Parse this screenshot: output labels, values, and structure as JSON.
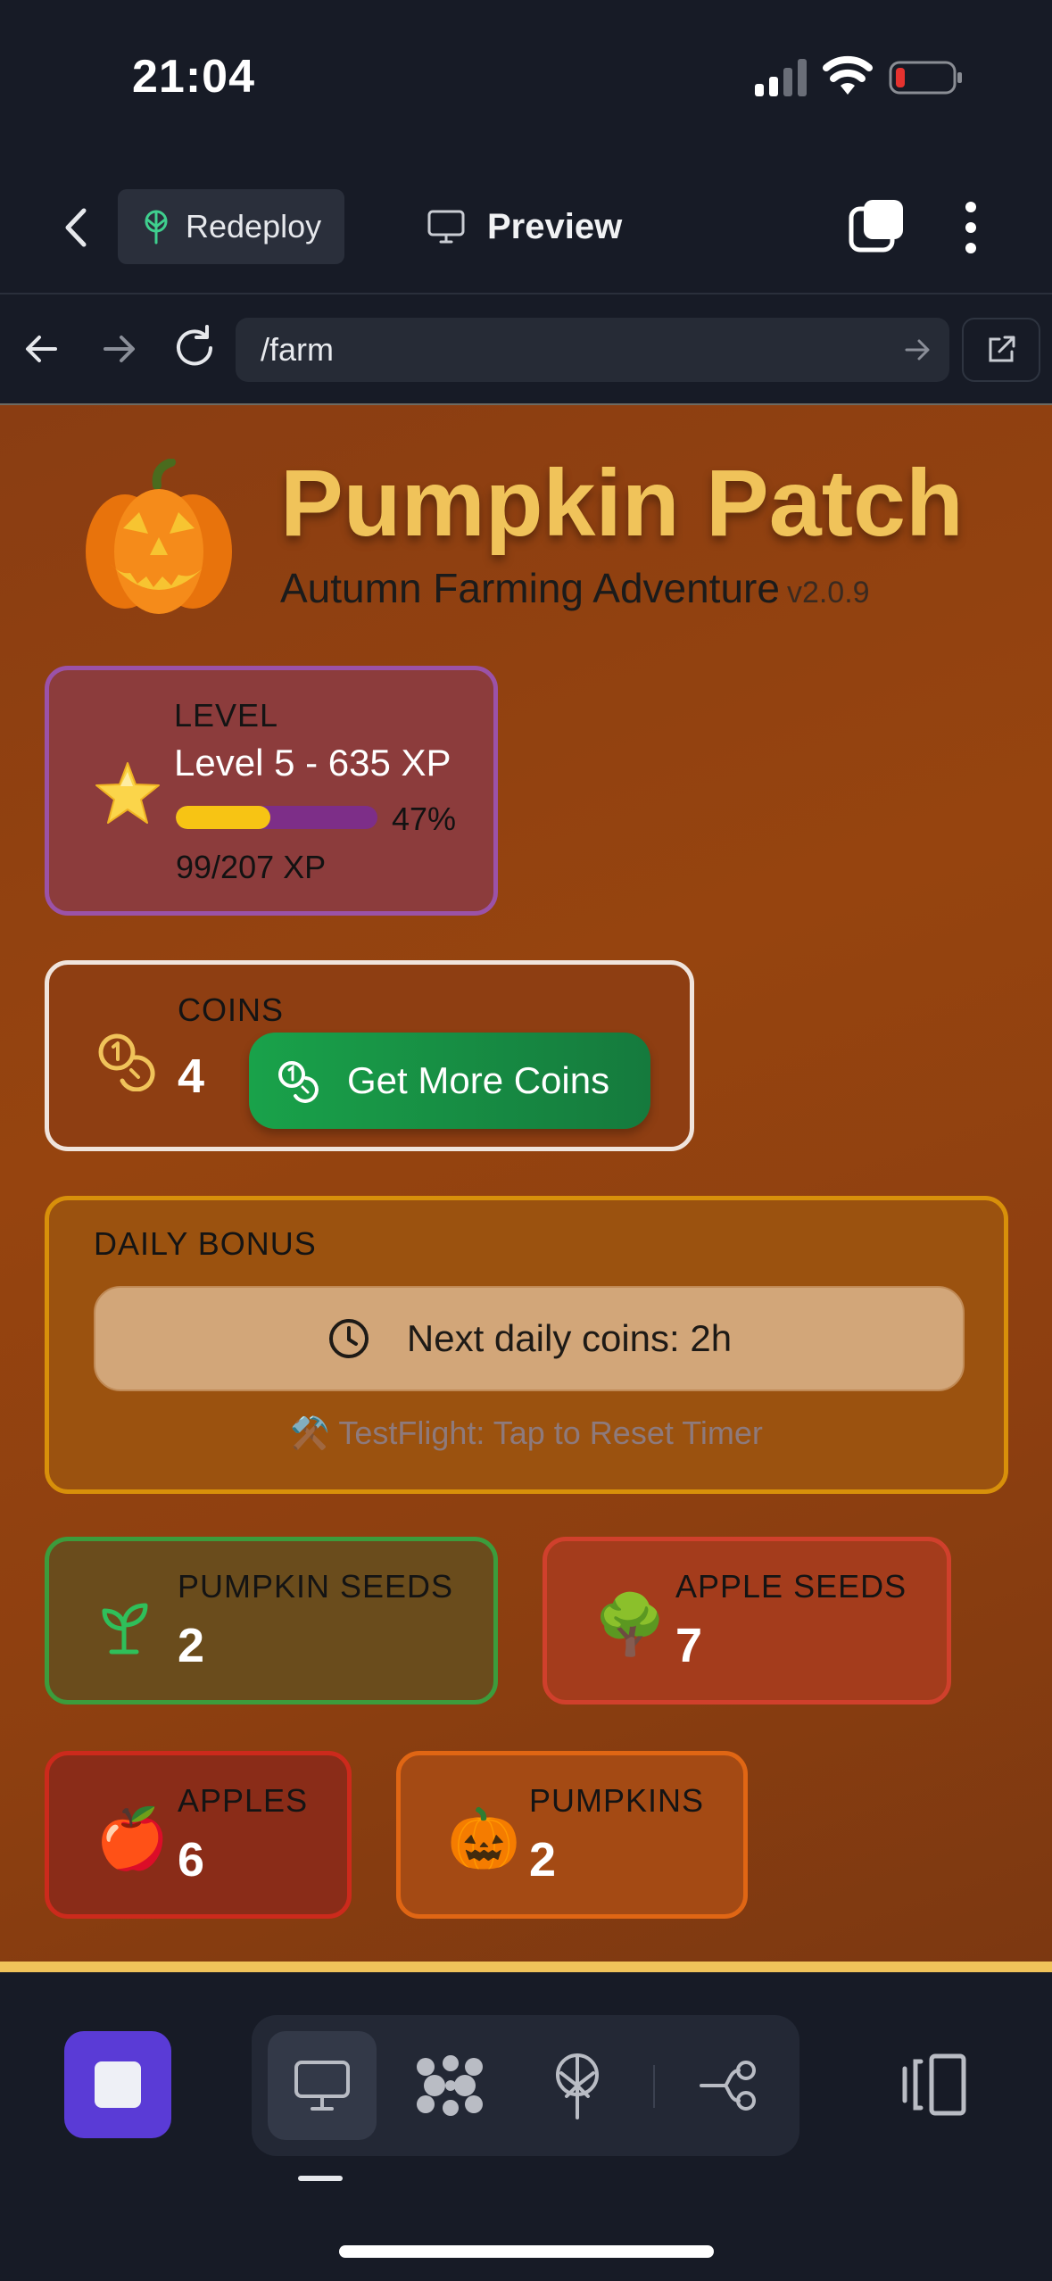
{
  "status_bar": {
    "time": "21:04",
    "icons": [
      "cellular-signal-icon",
      "wifi-icon",
      "battery-low-icon"
    ],
    "battery_color": "#e5322f"
  },
  "app_header": {
    "redeploy_label": "Redeploy",
    "preview_label": "Preview",
    "icons": [
      "back-chevron-icon",
      "redeploy-tree-icon",
      "monitor-icon",
      "tabs-icon",
      "more-vertical-icon"
    ],
    "redeploy_icon_color": "#3fcf8e"
  },
  "url_bar": {
    "value": "/farm",
    "icons": [
      "arrow-left-icon",
      "arrow-right-icon",
      "reload-icon",
      "go-arrow-icon",
      "external-link-icon"
    ]
  },
  "game": {
    "title": "Pumpkin Patch",
    "subtitle": "Autumn Farming Adventure",
    "version": "v2.0.9",
    "title_color": "#f0c35a",
    "level": {
      "caption": "LEVEL",
      "text": "Level 5 - 635 XP",
      "progress_fraction": 0.47,
      "progress_text": "47%",
      "xp_text": "99/207 XP",
      "icon": "star-icon"
    },
    "coins": {
      "caption": "COINS",
      "value": "4",
      "button_label": "Get More Coins",
      "icon": "coins-icon",
      "button_color": "#19a24a"
    },
    "daily_bonus": {
      "caption": "DAILY BONUS",
      "button_label": "Next daily coins: 2h",
      "reset_emoji": "⚒️",
      "reset_label": "TestFlight: Tap to Reset Timer",
      "icon": "clock-icon"
    },
    "inventory": {
      "pumpkin_seeds": {
        "caption": "PUMPKIN SEEDS",
        "value": "2",
        "icon": "sprout-icon"
      },
      "apple_seeds": {
        "caption": "APPLE SEEDS",
        "value": "7",
        "emoji": "🌳"
      },
      "apples": {
        "caption": "APPLES",
        "value": "6",
        "emoji": "🍎"
      },
      "pumpkins": {
        "caption": "PUMPKINS",
        "value": "2",
        "emoji": "🎃"
      }
    }
  },
  "toolbar": {
    "icons": [
      "stop-icon",
      "monitor-icon",
      "apps-grid-icon",
      "deploy-tree-icon",
      "workflow-icon",
      "side-panel-icon"
    ],
    "stop_color": "#5a3bd6"
  }
}
